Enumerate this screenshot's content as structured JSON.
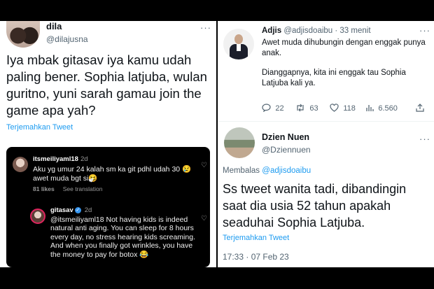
{
  "left_tweet": {
    "name": "dila",
    "handle": "@dilajusna",
    "more": "···",
    "text": "Iya mbak gitasav iya kamu udah paling bener. Sophia latjuba, wulan guritno, yuni sarah gamau join the game apa yah?",
    "translate": "Terjemahkan Tweet"
  },
  "ig": {
    "comment1": {
      "user": "itsmeiliyaml18",
      "time": "2d",
      "text": "Aku yg umur 24 kalah sm ka git pdhl udah 30 😢 awet muda bgt si🤧",
      "likes": "81 likes",
      "see_translation": "See translation"
    },
    "comment2": {
      "user": "gitasav",
      "verified": "✓",
      "time": "2d",
      "text": "@itsmeiliyaml18 Not having kids is indeed natural anti aging. You can sleep for 8 hours every day, no stress hearing kids screaming. And when you finally got wrinkles, you have the money to pay for botox 😂"
    },
    "heart": "♡"
  },
  "adjis": {
    "name": "Adjis",
    "handle": "@adjisdoaibu",
    "time": "· 33 menit",
    "more": "···",
    "text_line1": "Awet muda dihubungin dengan enggak punya anak.",
    "text_line2": "Dianggapnya, kita ini enggak tau Sophia Latjuba kali ya.",
    "replies": "22",
    "retweets": "63",
    "likes": "118",
    "views": "6.560",
    "icons": {
      "reply": "reply-icon",
      "retweet": "retweet-icon",
      "like": "heart-icon",
      "views": "views-icon",
      "share": "share-icon"
    }
  },
  "dzien": {
    "name": "Dzien Nuen",
    "handle": "@Dziennuen",
    "more": "···",
    "replying_label": "Membalas",
    "replying_handle": "@adjisdoaibu",
    "text": "Ss tweet wanita tadi, dibandingin saat dia usia 52 tahun apakah seaduhai Sophia Latjuba.",
    "translate": "Terjemahkan Tweet",
    "date": "17:33 · 07 Feb 23"
  },
  "colors": {
    "link": "#1d9bf0",
    "secondary": "#536471",
    "primary_text": "#0f1419"
  }
}
